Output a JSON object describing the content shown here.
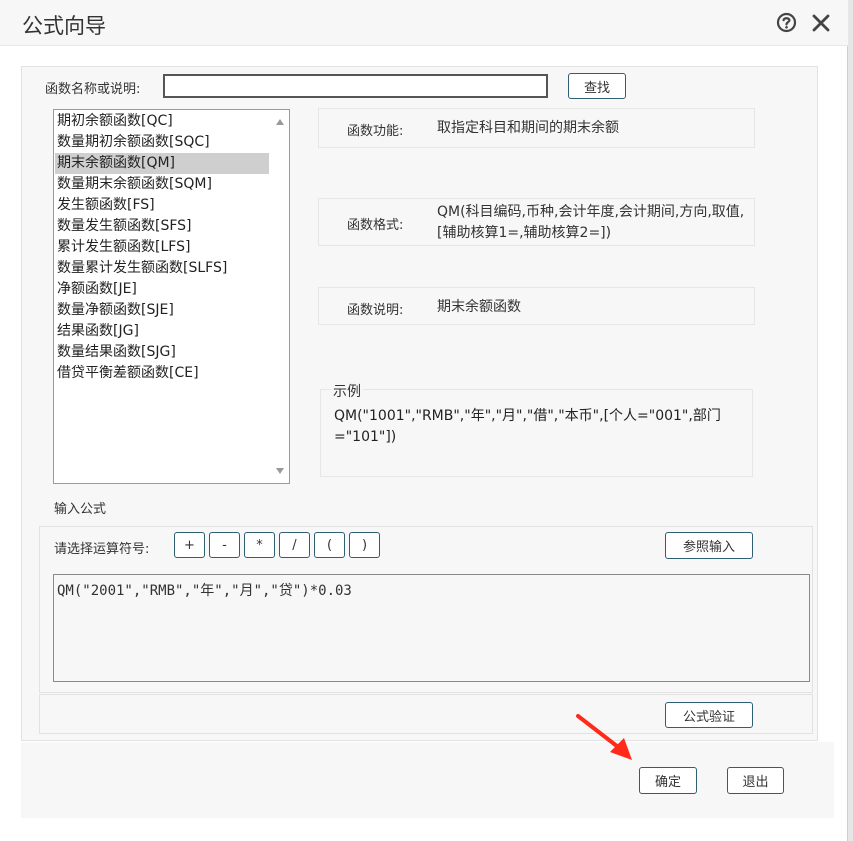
{
  "dialog": {
    "title": "公式向导"
  },
  "search": {
    "label": "函数名称或说明:",
    "value": "",
    "button_label": "查找"
  },
  "functions": [
    "期初余额函数[QC]",
    "数量期初余额函数[SQC]",
    "期末余额函数[QM]",
    "数量期末余额函数[SQM]",
    "发生额函数[FS]",
    "数量发生额函数[SFS]",
    "累计发生额函数[LFS]",
    "数量累计发生额函数[SLFS]",
    "净额函数[JE]",
    "数量净额函数[SJE]",
    "结果函数[JG]",
    "数量结果函数[SJG]",
    "借贷平衡差额函数[CE]"
  ],
  "selected_function_index": 2,
  "details": {
    "function_label": "函数功能:",
    "function_value": "取指定科目和期间的期末余额",
    "format_label": "函数格式:",
    "format_value": "QM(科目编码,币种,会计年度,会计期间,方向,取值,[辅助核算1=,辅助核算2=])",
    "desc_label": "函数说明:",
    "desc_value": "期末余额函数"
  },
  "example": {
    "legend": "示例",
    "text": "QM(\"1001\",\"RMB\",\"年\",\"月\",\"借\",\"本币\",[个人=\"001\",部门=\"101\"])"
  },
  "formula": {
    "section_label": "输入公式",
    "ops_label": "请选择运算符号:",
    "operators": [
      "+",
      "-",
      "*",
      "/",
      "(",
      ")"
    ],
    "reference_button": "参照输入",
    "value": "QM(\"2001\",\"RMB\",\"年\",\"月\",\"贷\")*0.03",
    "verify_button": "公式验证"
  },
  "footer": {
    "ok_button": "确定",
    "exit_button": "退出"
  },
  "colors": {
    "accent_border": "#2e5f73",
    "annotation_arrow": "#ff2a1a",
    "selected_row": "#cfcfcf"
  }
}
